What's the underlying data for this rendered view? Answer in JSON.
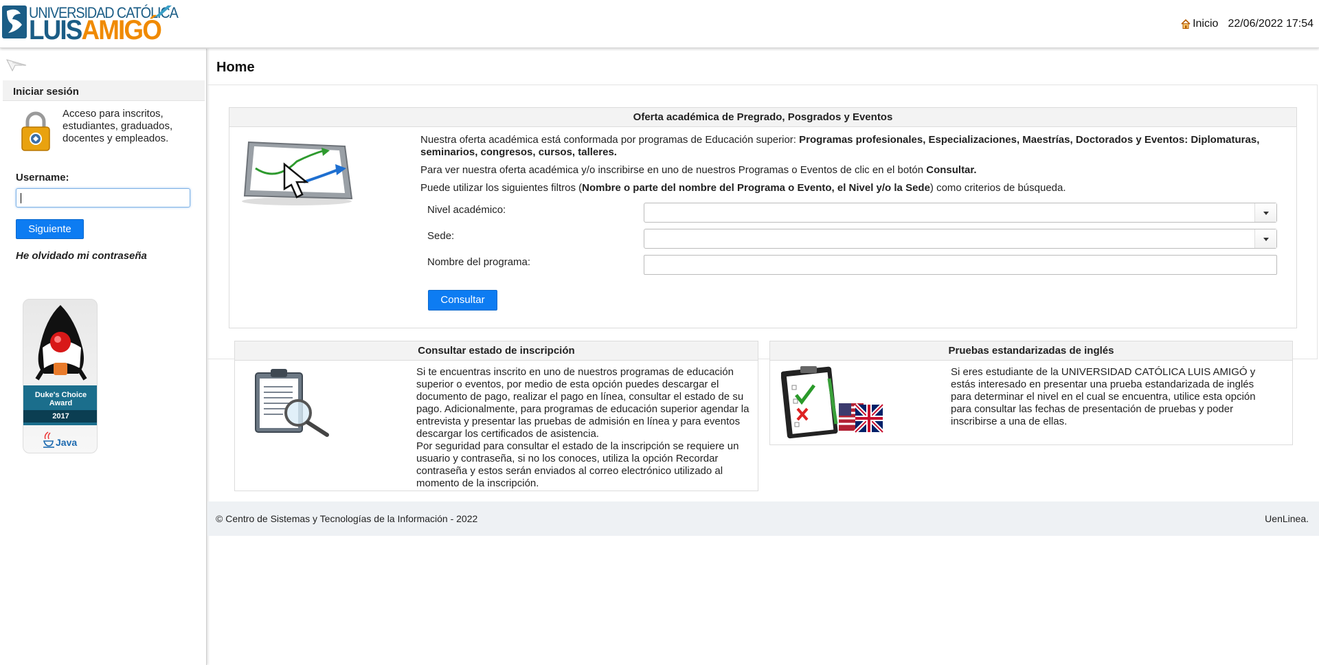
{
  "header": {
    "logo_line1": "UNIVERSIDAD CATÓLICA",
    "logo_line2_a": "LUIS",
    "logo_line2_b": "AMIGÓ",
    "home_link": "Inicio",
    "datetime": "22/06/2022 17:54"
  },
  "sidebar": {
    "login_title": "Iniciar sesión",
    "access_text": "Acceso para inscritos, estudiantes, graduados, docentes y empleados.",
    "username_label": "Username:",
    "username_value": "",
    "next_button": "Siguiente",
    "forgot_link": "He olvidado mi contraseña",
    "award": {
      "title_line1": "Duke's Choice",
      "title_line2": "Award",
      "year": "2017",
      "java": "Java"
    }
  },
  "main": {
    "page_title": "Home",
    "oferta": {
      "title": "Oferta académica de Pregrado, Posgrados y Eventos",
      "p1_plain": "Nuestra oferta académica está conformada por programas de Educación superior: ",
      "p1_bold": "Programas profesionales, Especializaciones, Maestrías, Doctorados y Eventos: Diplomaturas, seminarios, congresos, cursos, talleres.",
      "p2_plain": "Para ver nuestra oferta académica y/o inscribirse en uno de nuestros Programas o Eventos de clic en el botón ",
      "p2_bold": "Consultar.",
      "p3_plain_a": "Puede utilizar los siguientes filtros (",
      "p3_bold": "Nombre o parte del nombre del Programa o Evento, el Nivel y/o la Sede",
      "p3_plain_b": ") como criterios de búsqueda.",
      "nivel_label": "Nivel académico:",
      "nivel_value": "",
      "sede_label": "Sede:",
      "sede_value": "",
      "programa_label": "Nombre del programa:",
      "programa_value": "",
      "consultar_button": "Consultar"
    },
    "estado": {
      "title": "Consultar estado de inscripción",
      "text1": "Si te encuentras inscrito en uno de nuestros programas de educación superior o eventos, por medio de esta opción puedes descargar el documento de pago, realizar el pago en línea, consultar el estado de su pago. Adicionalmente, para programas de educación superior agendar la entrevista y presentar las pruebas de admisión en línea y para eventos descargar los certificados de asistencia.",
      "text2": "Por seguridad para consultar el estado de la inscripción se requiere un usuario y contraseña, si no los conoces, utiliza la opción Recordar contraseña y estos serán enviados al correo electrónico utilizado al momento de la inscripción."
    },
    "ingles": {
      "title": "Pruebas estandarizadas de inglés",
      "text": "Si eres estudiante de la UNIVERSIDAD CATÓLICA LUIS AMIGÓ y estás interesado en presentar una prueba estandarizada de inglés para determinar el nivel en el cual se encuentra, utilice esta opción para consultar las fechas de presentación de pruebas y poder inscribirse a una de ellas."
    },
    "footer": {
      "left": "© Centro de Sistemas y Tecnologías de la Información - 2022",
      "right": "UenLinea."
    }
  },
  "colors": {
    "primary_button": "#0d7cf2",
    "logo_blue": "#1b5d86",
    "logo_orange": "#f08a00"
  }
}
